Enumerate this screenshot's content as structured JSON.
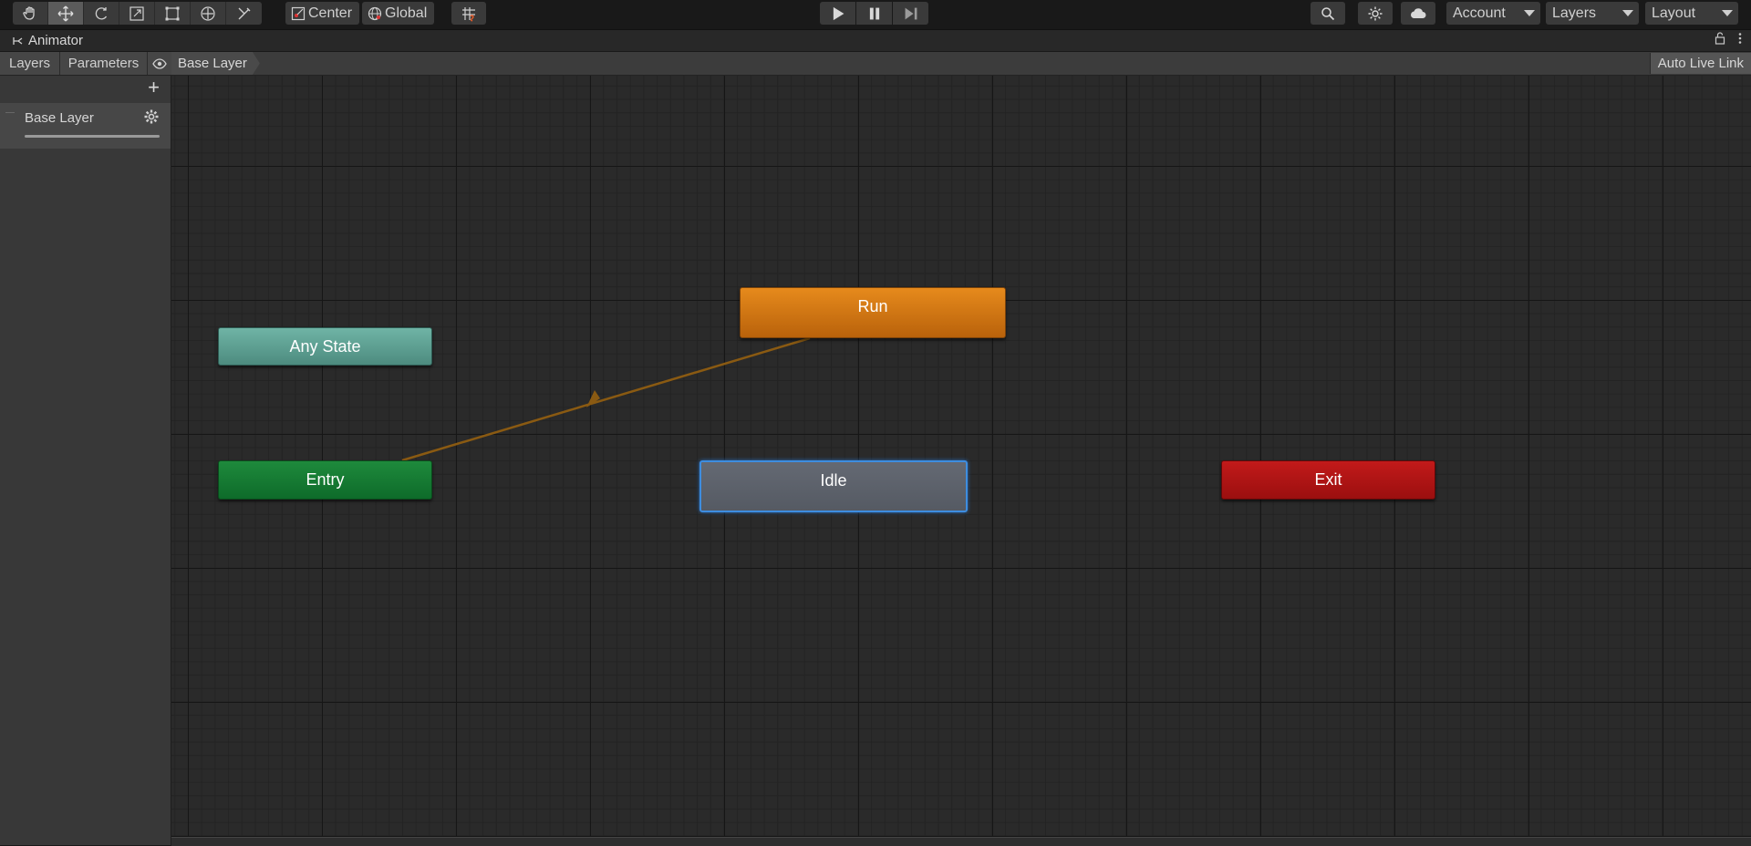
{
  "toolbar": {
    "tools": [
      "hand-icon",
      "move-icon",
      "rotate-icon",
      "scale-icon",
      "rect-icon",
      "transform-icon",
      "custom-tool-icon"
    ],
    "active_tool": "move-icon",
    "pivot_label": "Center",
    "space_label": "Global",
    "play_controls": [
      "play-icon",
      "pause-icon",
      "step-icon"
    ],
    "account_label": "Account",
    "layers_label": "Layers",
    "layout_label": "Layout"
  },
  "window": {
    "title": "Animator"
  },
  "tabs": {
    "layers": "Layers",
    "parameters": "Parameters",
    "breadcrumb": "Base Layer",
    "auto_live_link": "Auto Live Link"
  },
  "layers_panel": {
    "items": [
      {
        "name": "Base Layer"
      }
    ]
  },
  "graph": {
    "states": {
      "any_state": "Any State",
      "entry": "Entry",
      "run": "Run",
      "idle": "Idle",
      "exit": "Exit"
    },
    "selected_state": "Idle",
    "colors": {
      "any_state": "#5a9c90",
      "entry": "#137a33",
      "run": "#d27615",
      "idle": "#5c6069",
      "exit": "#ae1414",
      "transition": "#8a5a12",
      "selection": "#3d8de0"
    }
  }
}
